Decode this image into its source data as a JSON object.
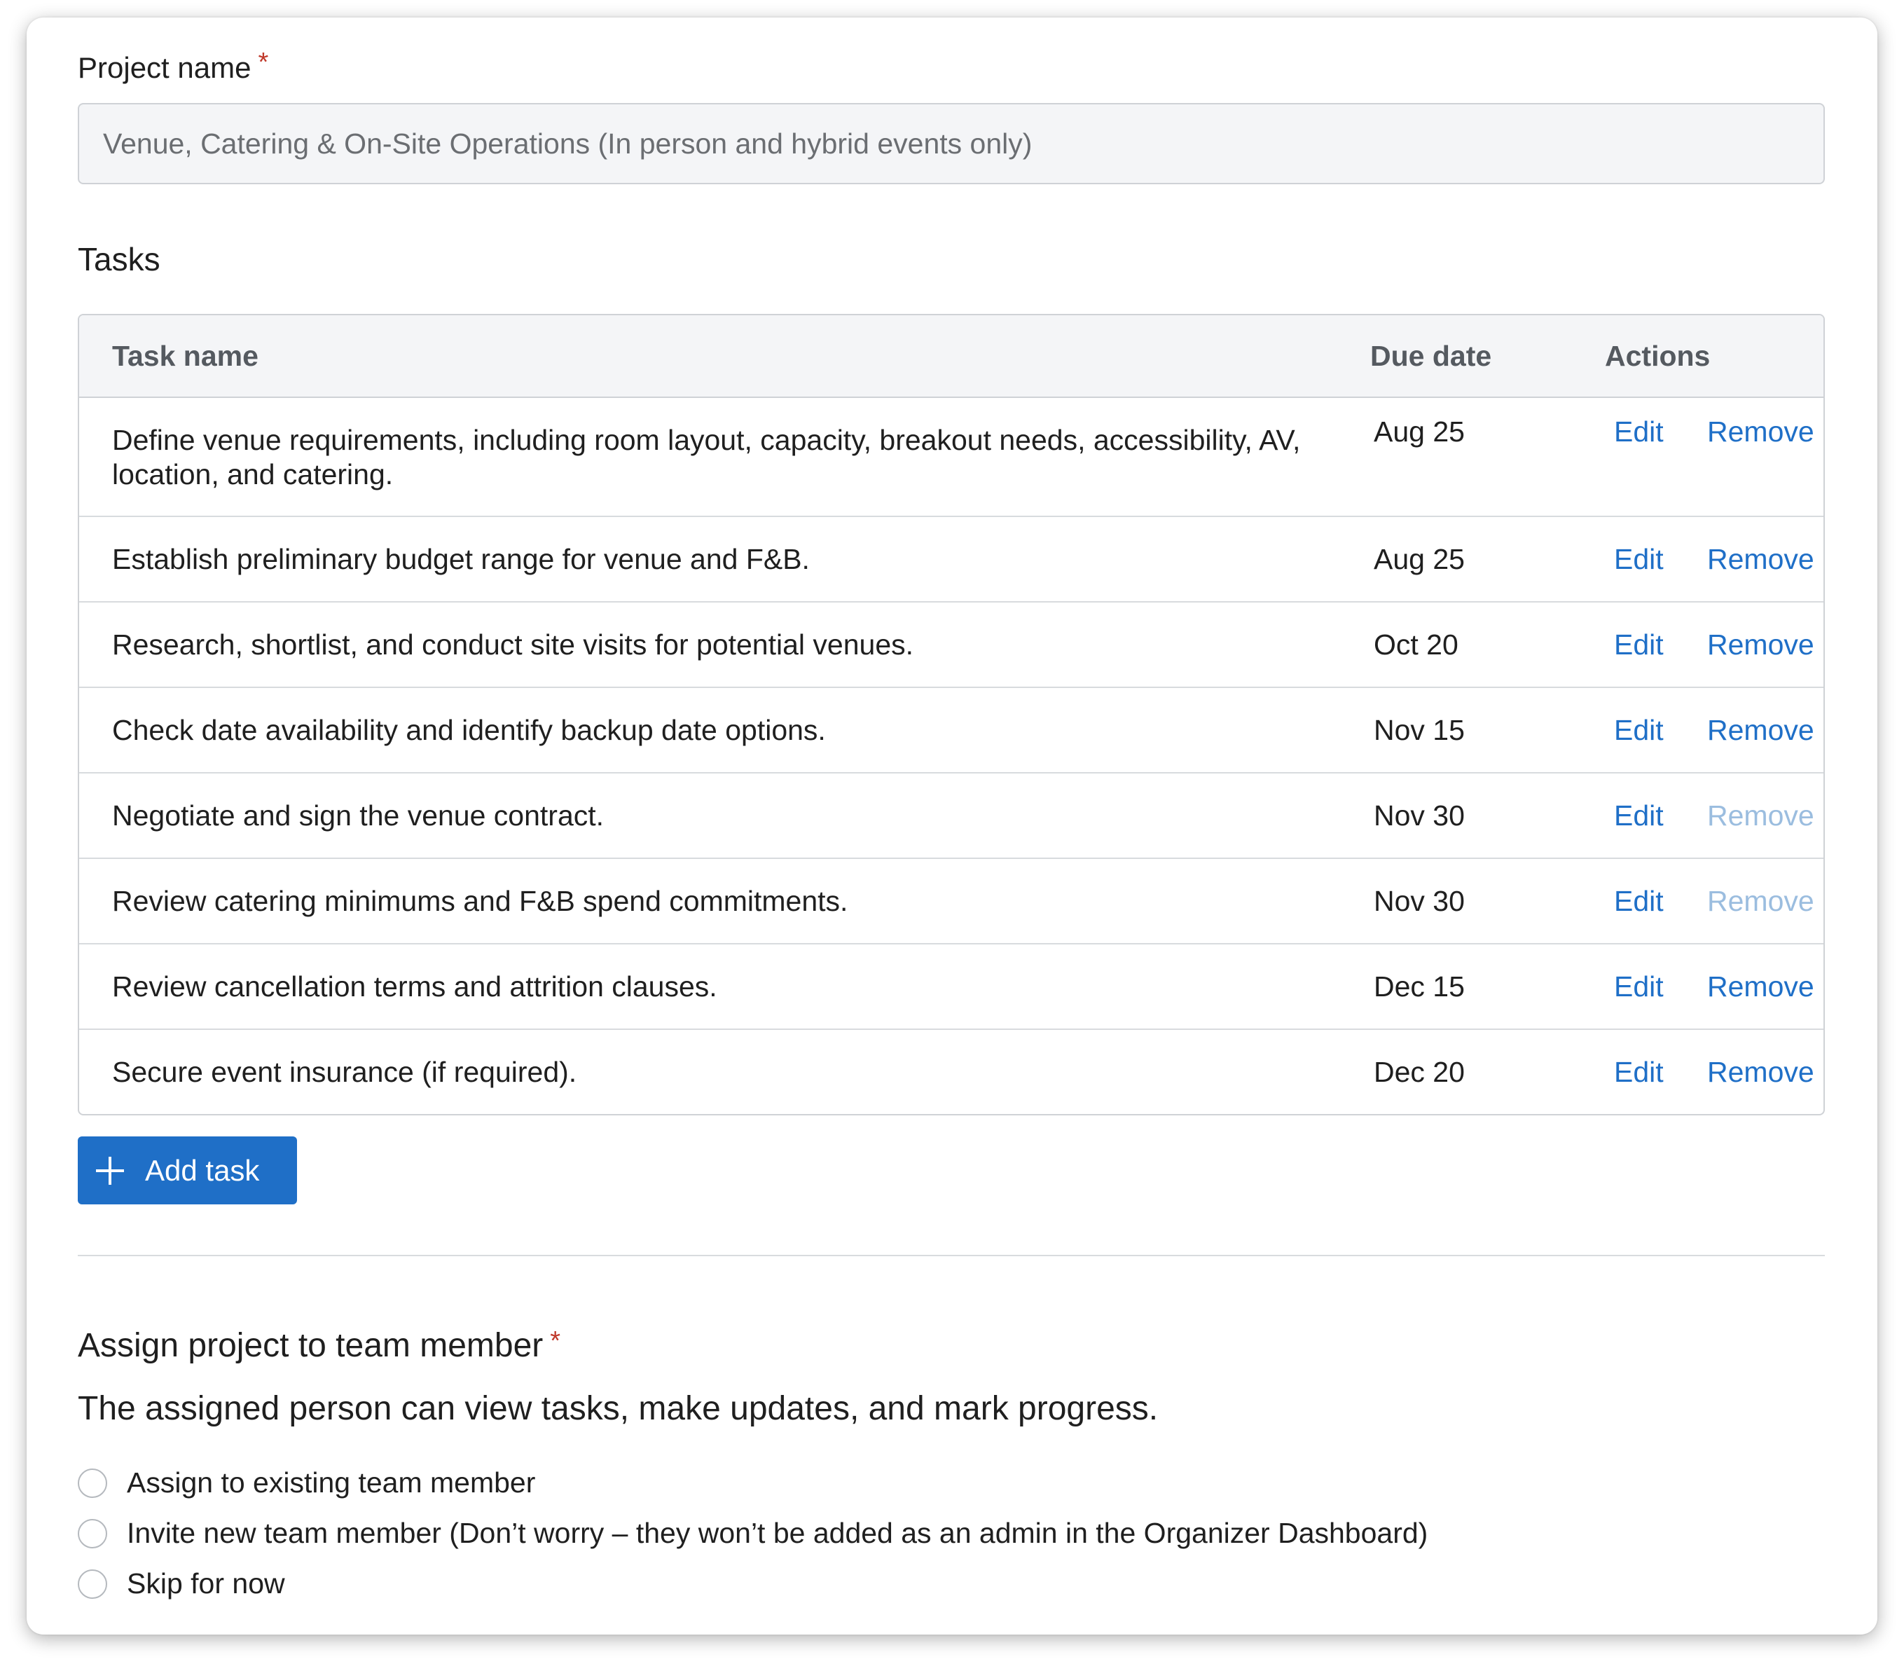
{
  "project": {
    "label": "Project name",
    "required_mark": "*",
    "value": "Venue, Catering & On-Site Operations (In person and hybrid events only)"
  },
  "tasks_section": {
    "title": "Tasks",
    "headers": {
      "task": "Task name",
      "due": "Due date",
      "actions": "Actions"
    },
    "rows": [
      {
        "task": "Define venue requirements, including room layout, capacity, breakout needs, accessibility, AV, location, and catering.",
        "due": "Aug 25",
        "edit": "Edit",
        "remove": "Remove",
        "remove_enabled": true
      },
      {
        "task": "Establish preliminary budget range for venue and F&B.",
        "due": "Aug 25",
        "edit": "Edit",
        "remove": "Remove",
        "remove_enabled": true
      },
      {
        "task": "Research, shortlist, and conduct site visits for potential venues.",
        "due": "Oct 20",
        "edit": "Edit",
        "remove": "Remove",
        "remove_enabled": true
      },
      {
        "task": "Check date availability and identify backup date options.",
        "due": "Nov 15",
        "edit": "Edit",
        "remove": "Remove",
        "remove_enabled": true
      },
      {
        "task": "Negotiate and sign the venue contract.",
        "due": "Nov 30",
        "edit": "Edit",
        "remove": "Remove",
        "remove_enabled": false
      },
      {
        "task": "Review catering minimums and F&B spend commitments.",
        "due": "Nov 30",
        "edit": "Edit",
        "remove": "Remove",
        "remove_enabled": false
      },
      {
        "task": "Review cancellation terms and attrition clauses.",
        "due": "Dec 15",
        "edit": "Edit",
        "remove": "Remove",
        "remove_enabled": true
      },
      {
        "task": "Secure event insurance (if required).",
        "due": "Dec 20",
        "edit": "Edit",
        "remove": "Remove",
        "remove_enabled": true
      }
    ],
    "add_button": {
      "label": "Add task",
      "icon": "plus-icon"
    }
  },
  "assign": {
    "title": "Assign project to team member",
    "required_mark": "*",
    "description": "The assigned person can view tasks, make updates, and mark progress.",
    "options": [
      {
        "label": "Assign to existing team member",
        "selected": false
      },
      {
        "label": "Invite new team member (Don’t worry – they won’t be added as an admin in the Organizer Dashboard)",
        "selected": false
      },
      {
        "label": "Skip for now",
        "selected": false
      }
    ]
  },
  "colors": {
    "accent": "#1f6fc7",
    "required": "#c0392b",
    "disabled_link": "#9bbddf"
  }
}
